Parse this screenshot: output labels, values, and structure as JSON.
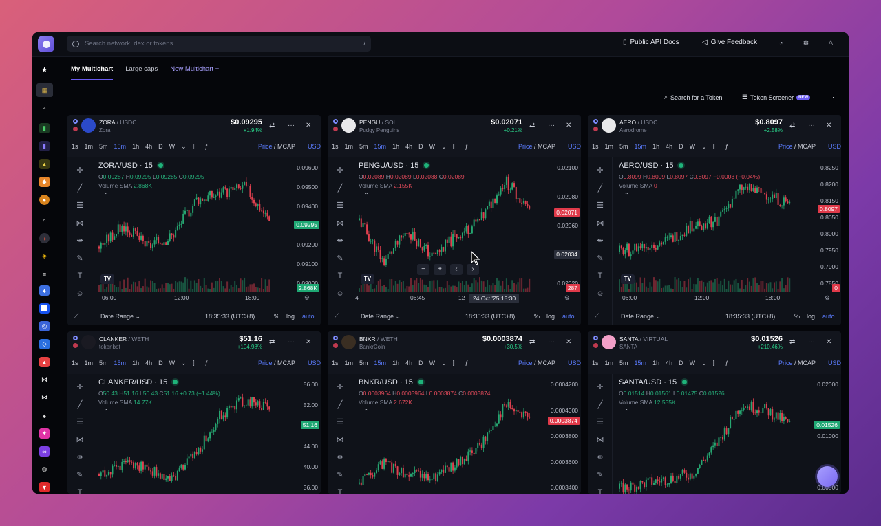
{
  "topbar": {
    "search_placeholder": "Search network, dex or tokens",
    "search_shortcut": "/",
    "api_docs": "Public API Docs",
    "feedback": "Give Feedback"
  },
  "tabs": [
    {
      "label": "My Multichart"
    },
    {
      "label": "Large caps"
    },
    {
      "label": "New Multichart"
    }
  ],
  "actions": {
    "search_token": "Search for a Token",
    "token_screener": "Token Screener",
    "new_badge": "NEW",
    "more": "···"
  },
  "colors": {
    "accent": "#6b5cf2",
    "up": "#26b07b",
    "down": "#e04a5a",
    "link": "#5b7cff"
  },
  "timeframes": [
    "1s",
    "1m",
    "5m",
    "15m",
    "1h",
    "4h",
    "D",
    "W"
  ],
  "panel_labels": {
    "price": "Price",
    "mcap": "MCAP",
    "usd": "USD",
    "date_range": "Date Range",
    "pct": "%",
    "log": "log",
    "auto": "auto",
    "time": "18:35:33 (UTC+8)"
  },
  "panels": [
    {
      "base": "ZORA",
      "quote": "USDC",
      "name": "Zora",
      "price": "$0.09295",
      "change": "+1.94%",
      "title": "ZORA/USD · 15",
      "ohlc": {
        "o": "0.09287",
        "h": "0.09295",
        "l": "0.09285",
        "c": "0.09295",
        "extra": ""
      },
      "volume_sma": "2.868K",
      "y_ticks": [
        "0.09600",
        "0.09500",
        "0.09400",
        "0.09300",
        "0.09200",
        "0.09100",
        "0.09000"
      ],
      "price_tag": "0.09295",
      "vol_tag": "2.868K",
      "x_ticks": [
        "06:00",
        "12:00",
        "18:00"
      ]
    },
    {
      "base": "PENGU",
      "quote": "SOL",
      "name": "Pudgy Penguins",
      "price": "$0.02071",
      "change": "+0.21%",
      "title": "PENGU/USD · 15",
      "ohlc": {
        "o": "0.02089",
        "h": "0.02089",
        "l": "0.02088",
        "c": "0.02089",
        "extra": ""
      },
      "volume_sma": "2.155K",
      "y_ticks": [
        "0.02100",
        "0.02080",
        "0.02060",
        "0.02040",
        "0.02020"
      ],
      "price_tag": "0.02071",
      "vol_tag": "287",
      "cross_tag": "0.02034",
      "x_ticks": [
        "4",
        "06:45",
        "12"
      ],
      "cursor_time": "24 Oct '25   15:30"
    },
    {
      "base": "AERO",
      "quote": "USDC",
      "name": "Aerodrome",
      "price": "$0.8097",
      "change": "+2.58%",
      "title": "AERO/USD · 15",
      "ohlc": {
        "o": "0.8099",
        "h": "0.8099",
        "l": "0.8097",
        "c": "0.8097",
        "extra": "−0.0003 (−0.04%)"
      },
      "volume_sma": "0",
      "y_ticks": [
        "0.8250",
        "0.8200",
        "0.8150",
        "0.8050",
        "0.8000",
        "0.7950",
        "0.7900",
        "0.7850"
      ],
      "price_tag": "0.8097",
      "vol_tag": "0",
      "x_ticks": [
        "06:00",
        "12:00",
        "18:00"
      ]
    },
    {
      "base": "CLANKER",
      "quote": "WETH",
      "name": "tokenbot",
      "price": "$51.16",
      "change": "+104.98%",
      "title": "CLANKER/USD · 15",
      "ohlc": {
        "o": "50.43",
        "h": "51.16",
        "l": "50.43",
        "c": "51.16",
        "extra": "+0.73 (+1.44%)"
      },
      "volume_sma": "14.77K",
      "y_ticks": [
        "56.00",
        "52.00",
        "48.00",
        "44.00",
        "40.00",
        "36.00"
      ],
      "price_tag": "51.16",
      "vol_tag": "",
      "x_ticks": []
    },
    {
      "base": "BNKR",
      "quote": "WETH",
      "name": "BankrCoin",
      "price": "$0.0003874",
      "change": "+30.5%",
      "title": "BNKR/USD · 15",
      "ohlc": {
        "o": "0.0003964",
        "h": "0.0003964",
        "l": "0.0003874",
        "c": "0.0003874",
        "extra": "…"
      },
      "volume_sma": "2.672K",
      "y_ticks": [
        "0.0004200",
        "0.0004000",
        "0.0003800",
        "0.0003600",
        "0.0003400"
      ],
      "price_tag": "0.0003874",
      "vol_tag": "",
      "x_ticks": []
    },
    {
      "base": "SANTA",
      "quote": "VIRTUAL",
      "name": "SANTA",
      "price": "$0.01526",
      "change": "+210.46%",
      "title": "SANTA/USD · 15",
      "ohlc": {
        "o": "0.01514",
        "h": "0.01561",
        "l": "0.01475",
        "c": "0.01526",
        "extra": "…"
      },
      "volume_sma": "12.535K",
      "y_ticks": [
        "0.02000",
        "0.01000",
        "0.00500"
      ],
      "price_tag": "0.01526",
      "vol_tag": "",
      "x_ticks": []
    }
  ]
}
